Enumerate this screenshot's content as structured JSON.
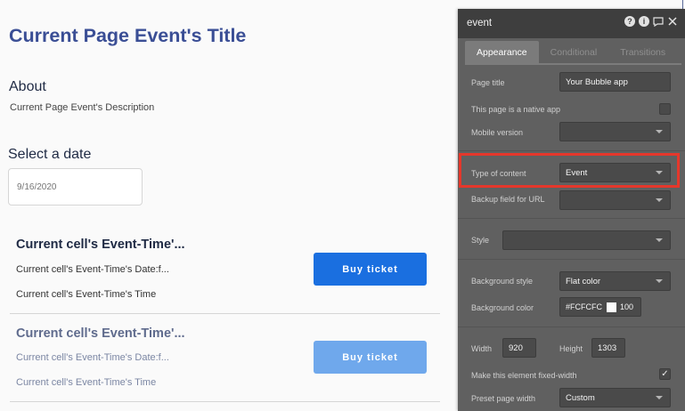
{
  "page": {
    "title": "Current Page Event's Title",
    "about_heading": "About",
    "about_description": "Current Page Event's Description",
    "date_heading": "Select a date",
    "date_placeholder": "9/16/2020",
    "cells": [
      {
        "title": "Current cell's Event-Time'...",
        "date_line": "Current cell's Event-Time's Date:f...",
        "time_line": "Current cell's Event-Time's Time",
        "button": "Buy ticket"
      },
      {
        "title": "Current cell's Event-Time'...",
        "date_line": "Current cell's Event-Time's Date:f...",
        "time_line": "Current cell's Event-Time's Time",
        "button": "Buy ticket"
      }
    ]
  },
  "editor": {
    "name": "event",
    "tabs": [
      "Appearance",
      "Conditional",
      "Transitions"
    ],
    "active_tab": "Appearance",
    "fields": {
      "page_title": {
        "label": "Page title",
        "value": "Your Bubble app"
      },
      "native_app": {
        "label": "This page is a native app",
        "checked": false
      },
      "mobile_version": {
        "label": "Mobile version",
        "value": ""
      },
      "type_of_content": {
        "label": "Type of content",
        "value": "Event"
      },
      "backup_field": {
        "label": "Backup field for URL",
        "value": ""
      },
      "style": {
        "label": "Style",
        "value": ""
      },
      "background_style": {
        "label": "Background style",
        "value": "Flat color"
      },
      "background_color": {
        "label": "Background color",
        "hex": "#FCFCFC",
        "opacity": "100"
      },
      "width": {
        "label": "Width",
        "value": "920"
      },
      "height": {
        "label": "Height",
        "value": "1303"
      },
      "fixed_width": {
        "label": "Make this element fixed-width",
        "checked": true
      },
      "preset_width": {
        "label": "Preset page width",
        "value": "Custom"
      }
    }
  },
  "colors": {
    "title": "#3a4e95",
    "button_primary": "#1a6fe0",
    "button_faded": "#6fa8ec",
    "editor_bg": "#606060",
    "highlight": "#e5372b"
  }
}
